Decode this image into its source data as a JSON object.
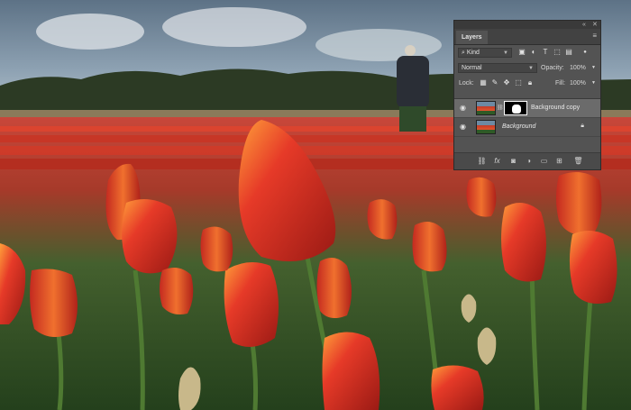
{
  "panel": {
    "tab_label": "Layers",
    "filter": {
      "kind_label": "Kind"
    },
    "blend_mode": "Normal",
    "opacity_label": "Opacity:",
    "opacity_value": "100%",
    "lock_label": "Lock:",
    "fill_label": "Fill:",
    "fill_value": "100%",
    "layers": [
      {
        "name": "Background copy",
        "selected": true,
        "has_mask": true
      },
      {
        "name": "Background",
        "selected": false,
        "locked": true
      }
    ]
  },
  "icons": {
    "close": "close-icon",
    "collapse": "collapse-icon",
    "menu": "panel-menu-icon",
    "eye": "eye-icon",
    "lock": "lock-icon"
  },
  "colors": {
    "panel_bg": "#535353",
    "selected_layer": "#6b6b6b",
    "tulip_red": "#d8342a"
  }
}
